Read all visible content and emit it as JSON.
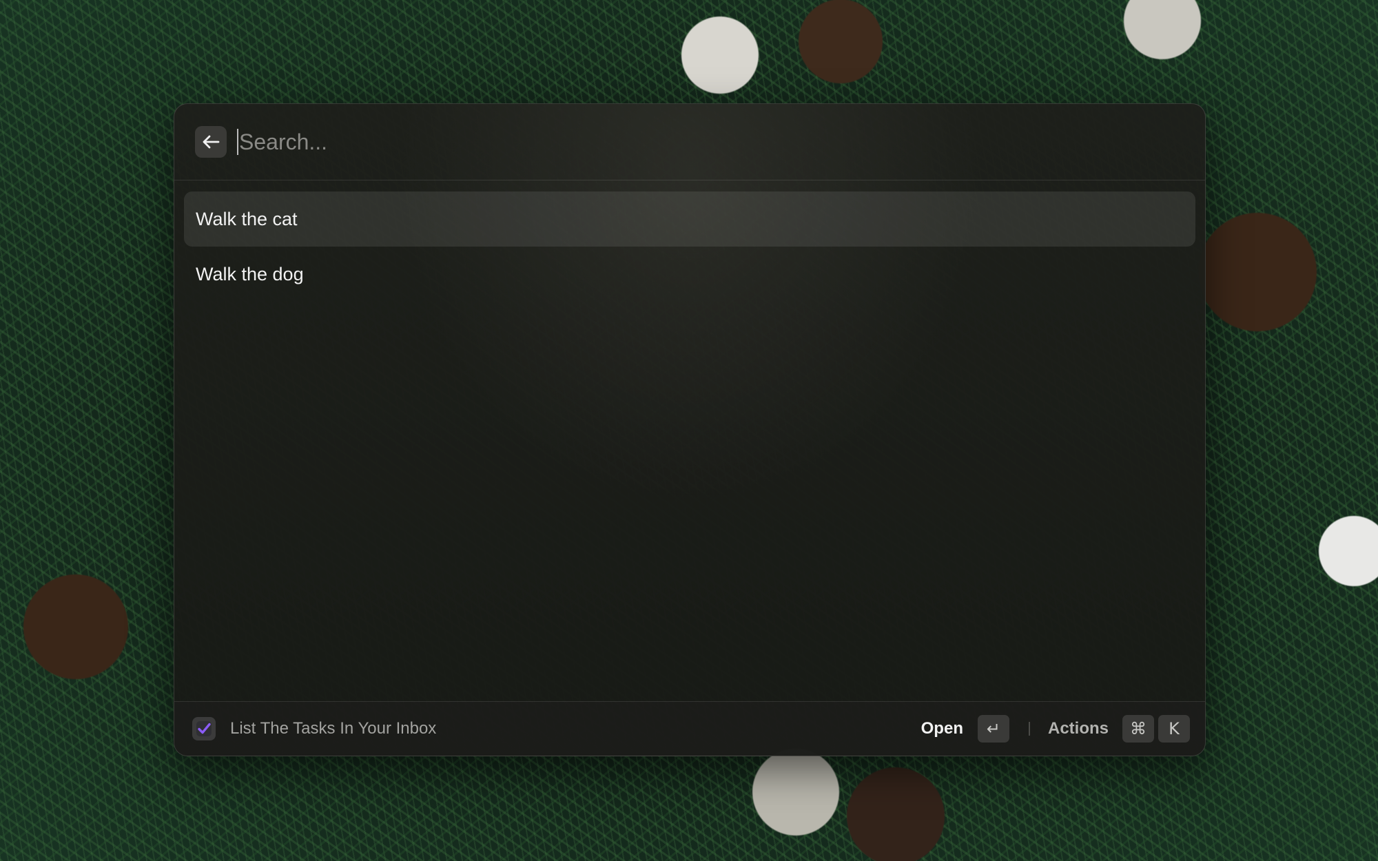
{
  "search": {
    "placeholder": "Search...",
    "value": ""
  },
  "icons": {
    "back": "arrow-left-icon",
    "extension": "checkbox-check-icon"
  },
  "tasks": [
    {
      "title": "Walk the cat",
      "selected": true
    },
    {
      "title": "Walk the dog",
      "selected": false
    }
  ],
  "footer": {
    "extension_title": "List The Tasks In Your Inbox",
    "primary_action": "Open",
    "primary_shortcut": "↵",
    "secondary_action": "Actions",
    "secondary_shortcut_keys": [
      "⌘",
      "K"
    ]
  },
  "colors": {
    "accent": "#8b5cf6",
    "selection_bg": "rgba(255,255,255,0.09)"
  }
}
